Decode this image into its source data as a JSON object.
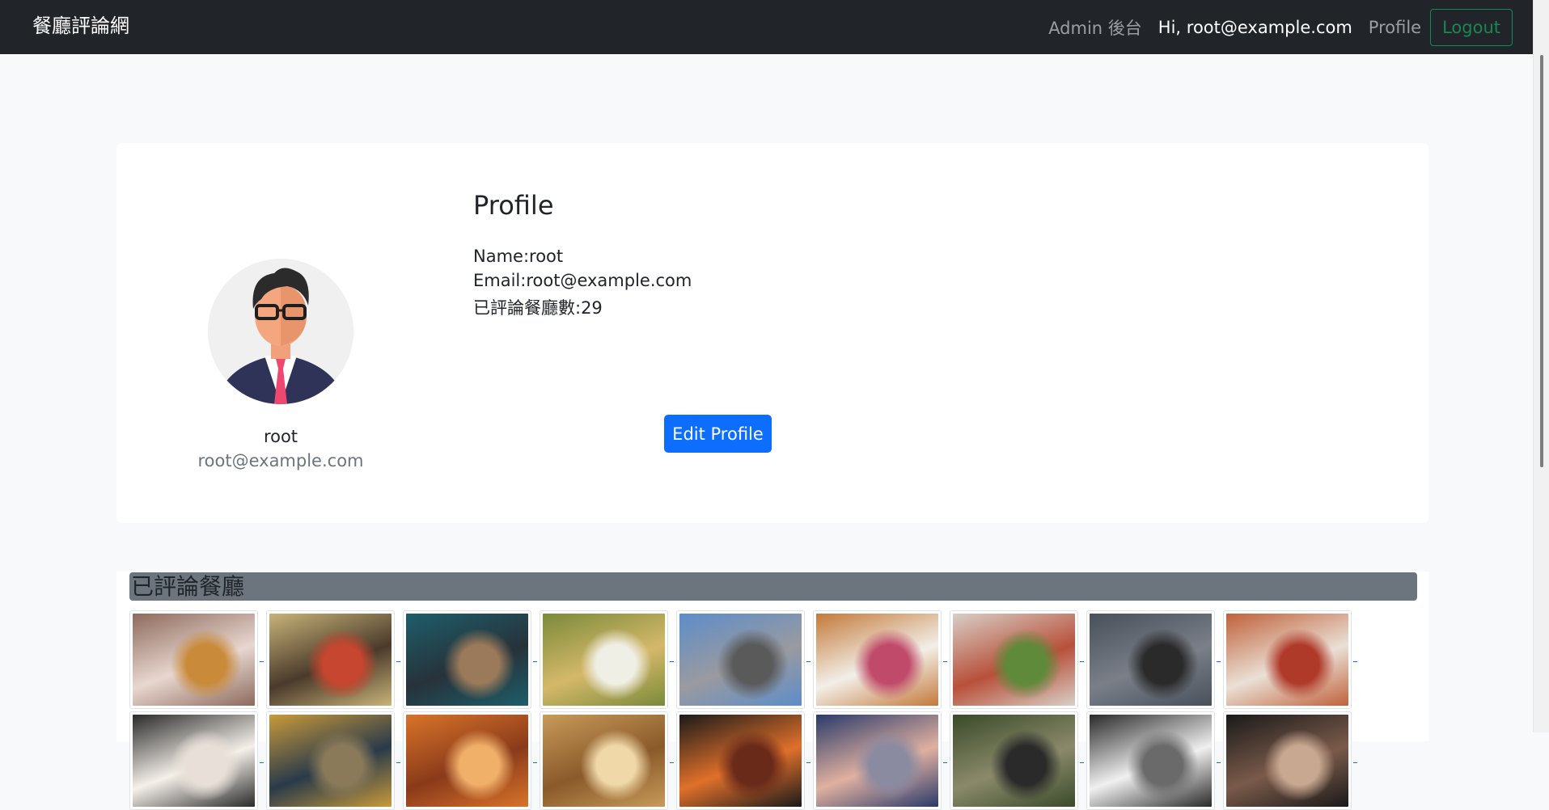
{
  "navbar": {
    "brand": "餐廳評論網",
    "admin_link": "Admin 後台",
    "greeting": "Hi, root@example.com",
    "profile_link": "Profile",
    "logout_label": "Logout"
  },
  "profile_card": {
    "avatar_icon": "user-avatar-icon",
    "name": "root",
    "email": "root@example.com",
    "heading": "Profile",
    "name_line": "Name:root",
    "email_line": "Email:root@example.com",
    "review_count_line": "已評論餐廳數:29",
    "edit_button": "Edit Profile"
  },
  "reviewed_restaurants": {
    "heading": "已評論餐廳",
    "thumbnails": [
      {
        "name": "steak-dish",
        "colors": [
          "#8d6a5c",
          "#e8d7d0",
          "#c98a3a"
        ]
      },
      {
        "name": "braised-pork-bowl",
        "colors": [
          "#c8b479",
          "#4a3a2b",
          "#c6462f"
        ]
      },
      {
        "name": "restaurant-storefront",
        "colors": [
          "#1d5e6a",
          "#27323a",
          "#9a7a5a"
        ]
      },
      {
        "name": "salad-plate",
        "colors": [
          "#7a8a3a",
          "#d5b86a",
          "#f0efe6"
        ]
      },
      {
        "name": "street-view",
        "colors": [
          "#5d8dc9",
          "#9a9aa0",
          "#5a5a5a"
        ]
      },
      {
        "name": "dessert-plate",
        "colors": [
          "#c4793a",
          "#f2efe8",
          "#c04a6a"
        ]
      },
      {
        "name": "pasta-noodles",
        "colors": [
          "#d8cfc6",
          "#b8503a",
          "#5f8a3a"
        ]
      },
      {
        "name": "street-sculpture",
        "colors": [
          "#48505a",
          "#7a7f88",
          "#2a2a2a"
        ]
      },
      {
        "name": "spaghetti-plate",
        "colors": [
          "#c0613a",
          "#eae0d6",
          "#b03a2a"
        ]
      },
      {
        "name": "cake-slice",
        "colors": [
          "#2a2a2a",
          "#f5f0ea",
          "#e8e0d8"
        ]
      },
      {
        "name": "menu-board",
        "colors": [
          "#c89a3a",
          "#2a3a4a",
          "#8a7a5a"
        ]
      },
      {
        "name": "orange-dish",
        "colors": [
          "#d8742a",
          "#8a3a1a",
          "#f0b06a"
        ]
      },
      {
        "name": "bread-loaf",
        "colors": [
          "#c89a5a",
          "#8a5a2a",
          "#f0d8a8"
        ]
      },
      {
        "name": "flame-grill",
        "colors": [
          "#1a1a1a",
          "#e0702a",
          "#6a2a1a"
        ]
      },
      {
        "name": "seafood-platter",
        "colors": [
          "#2a3a6a",
          "#e0b0a0",
          "#8a8aa0"
        ]
      },
      {
        "name": "market-street",
        "colors": [
          "#3a4a2a",
          "#8a8a6a",
          "#2a2a2a"
        ]
      },
      {
        "name": "dining-room",
        "colors": [
          "#2a2a2a",
          "#f0f0f0",
          "#6a6a6a"
        ]
      },
      {
        "name": "chef-portrait",
        "colors": [
          "#1a1a1a",
          "#7a5a4a",
          "#c8a890"
        ]
      }
    ]
  }
}
